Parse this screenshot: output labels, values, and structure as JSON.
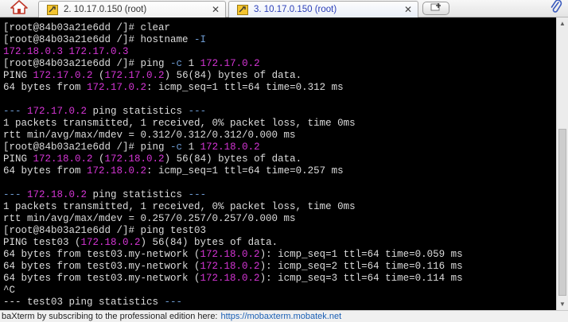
{
  "tabs": [
    {
      "label": "2. 10.17.0.150 (root)",
      "active": false,
      "close_glyph": "✕"
    },
    {
      "label": "3. 10.17.0.150 (root)",
      "active": true,
      "close_glyph": "✕"
    }
  ],
  "icons": {
    "home": "home-icon",
    "tab": "wrench-terminal-icon",
    "new_tab": "new-tab-icon",
    "attach": "paperclip-icon"
  },
  "colors": {
    "terminal_bg": "#000000",
    "terminal_text": "#dcdcdc",
    "highlight_ip": "#d535d5",
    "option_flag": "#6e9bd2",
    "active_tab_text": "#2b3fb8",
    "link": "#1a5fb4"
  },
  "terminal": {
    "lines": [
      {
        "segments": [
          {
            "t": "[root@84b03a21e6dd /]# clear",
            "k": "text"
          }
        ]
      },
      {
        "segments": [
          {
            "t": "[root@84b03a21e6dd /]# hostname ",
            "k": "text"
          },
          {
            "t": "-I",
            "k": "opt"
          }
        ]
      },
      {
        "segments": [
          {
            "t": "172.18.0.3 172.17.0.3",
            "k": "hl"
          }
        ]
      },
      {
        "segments": [
          {
            "t": "[root@84b03a21e6dd /]# ping ",
            "k": "text"
          },
          {
            "t": "-c",
            "k": "opt"
          },
          {
            "t": " 1 ",
            "k": "text"
          },
          {
            "t": "172.17.0.2",
            "k": "hl"
          }
        ]
      },
      {
        "segments": [
          {
            "t": "PING ",
            "k": "text"
          },
          {
            "t": "172.17.0.2",
            "k": "hl"
          },
          {
            "t": " (",
            "k": "text"
          },
          {
            "t": "172.17.0.2",
            "k": "hl"
          },
          {
            "t": ") 56(84) bytes of data.",
            "k": "text"
          }
        ]
      },
      {
        "segments": [
          {
            "t": "64 bytes from ",
            "k": "text"
          },
          {
            "t": "172.17.0.2",
            "k": "hl"
          },
          {
            "t": ": icmp_seq=1 ttl=64 time=0.312 ms",
            "k": "text"
          }
        ]
      },
      {
        "segments": [
          {
            "t": "",
            "k": "text"
          }
        ]
      },
      {
        "segments": [
          {
            "t": "--- ",
            "k": "opt"
          },
          {
            "t": "172.17.0.2",
            "k": "hl"
          },
          {
            "t": " ping statistics ",
            "k": "text"
          },
          {
            "t": "---",
            "k": "opt"
          }
        ]
      },
      {
        "segments": [
          {
            "t": "1 packets transmitted, 1 received, 0% packet loss, time 0ms",
            "k": "text"
          }
        ]
      },
      {
        "segments": [
          {
            "t": "rtt min/avg/max/mdev = 0.312/0.312/0.312/0.000 ms",
            "k": "text"
          }
        ]
      },
      {
        "segments": [
          {
            "t": "[root@84b03a21e6dd /]# ping ",
            "k": "text"
          },
          {
            "t": "-c",
            "k": "opt"
          },
          {
            "t": " 1 ",
            "k": "text"
          },
          {
            "t": "172.18.0.2",
            "k": "hl"
          }
        ]
      },
      {
        "segments": [
          {
            "t": "PING ",
            "k": "text"
          },
          {
            "t": "172.18.0.2",
            "k": "hl"
          },
          {
            "t": " (",
            "k": "text"
          },
          {
            "t": "172.18.0.2",
            "k": "hl"
          },
          {
            "t": ") 56(84) bytes of data.",
            "k": "text"
          }
        ]
      },
      {
        "segments": [
          {
            "t": "64 bytes from ",
            "k": "text"
          },
          {
            "t": "172.18.0.2",
            "k": "hl"
          },
          {
            "t": ": icmp_seq=1 ttl=64 time=0.257 ms",
            "k": "text"
          }
        ]
      },
      {
        "segments": [
          {
            "t": "",
            "k": "text"
          }
        ]
      },
      {
        "segments": [
          {
            "t": "--- ",
            "k": "opt"
          },
          {
            "t": "172.18.0.2",
            "k": "hl"
          },
          {
            "t": " ping statistics ",
            "k": "text"
          },
          {
            "t": "---",
            "k": "opt"
          }
        ]
      },
      {
        "segments": [
          {
            "t": "1 packets transmitted, 1 received, 0% packet loss, time 0ms",
            "k": "text"
          }
        ]
      },
      {
        "segments": [
          {
            "t": "rtt min/avg/max/mdev = 0.257/0.257/0.257/0.000 ms",
            "k": "text"
          }
        ]
      },
      {
        "segments": [
          {
            "t": "[root@84b03a21e6dd /]# ping test03",
            "k": "text"
          }
        ]
      },
      {
        "segments": [
          {
            "t": "PING test03 (",
            "k": "text"
          },
          {
            "t": "172.18.0.2",
            "k": "hl"
          },
          {
            "t": ") 56(84) bytes of data.",
            "k": "text"
          }
        ]
      },
      {
        "segments": [
          {
            "t": "64 bytes from test03.my-network (",
            "k": "text"
          },
          {
            "t": "172.18.0.2",
            "k": "hl"
          },
          {
            "t": "): icmp_seq=1 ttl=64 time=0.059 ms",
            "k": "text"
          }
        ]
      },
      {
        "segments": [
          {
            "t": "64 bytes from test03.my-network (",
            "k": "text"
          },
          {
            "t": "172.18.0.2",
            "k": "hl"
          },
          {
            "t": "): icmp_seq=2 ttl=64 time=0.116 ms",
            "k": "text"
          }
        ]
      },
      {
        "segments": [
          {
            "t": "64 bytes from test03.my-network (",
            "k": "text"
          },
          {
            "t": "172.18.0.2",
            "k": "hl"
          },
          {
            "t": "): icmp_seq=3 ttl=64 time=0.114 ms",
            "k": "text"
          }
        ]
      },
      {
        "segments": [
          {
            "t": "^C",
            "k": "text"
          }
        ]
      },
      {
        "segments": [
          {
            "t": "--- test03 ping statistics ",
            "k": "text"
          },
          {
            "t": "---",
            "k": "opt"
          }
        ]
      }
    ]
  },
  "scrollbar": {
    "up_arrow": "▲",
    "down_arrow": "▼"
  },
  "statusbar": {
    "message": "baXterm by subscribing to the professional edition here:",
    "link": "https://mobaxterm.mobatek.net"
  }
}
